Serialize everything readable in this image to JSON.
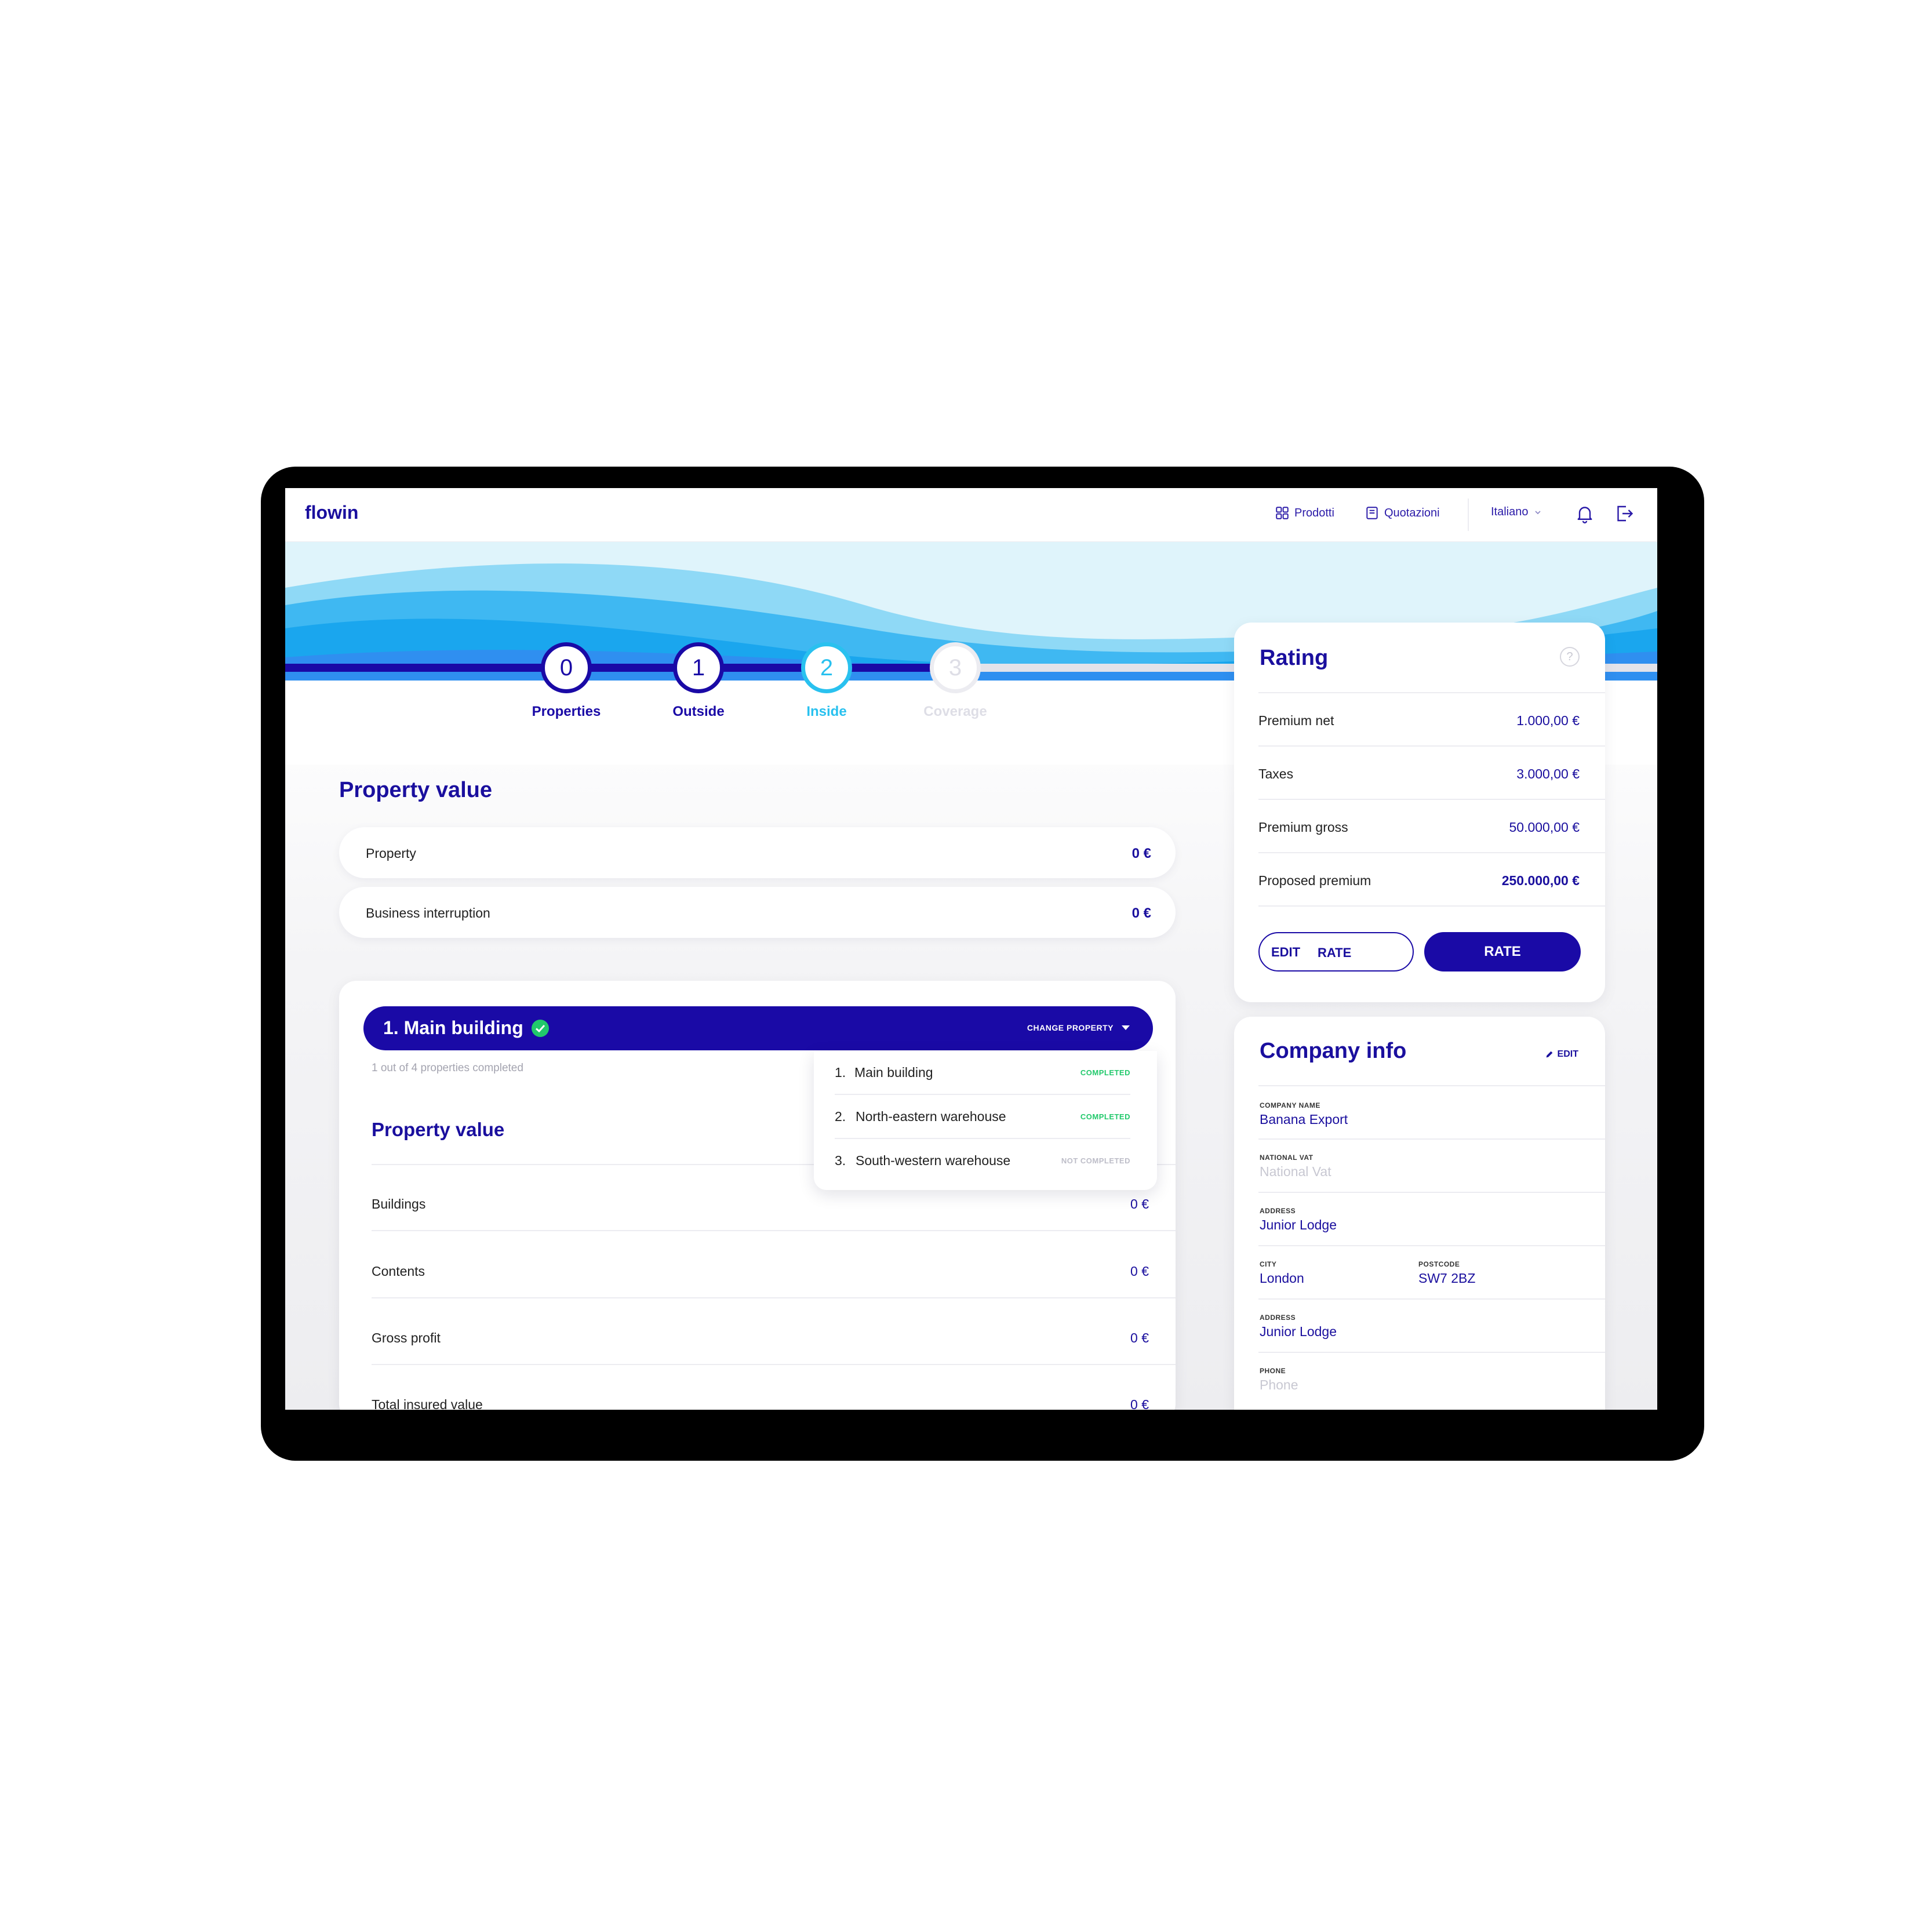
{
  "header": {
    "logo": "flowin",
    "nav": [
      {
        "label": "Prodotti",
        "icon": "grid-icon"
      },
      {
        "label": "Quotazioni",
        "icon": "document-icon"
      }
    ],
    "language": "Italiano",
    "icons": [
      "bell-icon",
      "logout-icon"
    ]
  },
  "stepper": {
    "steps": [
      {
        "number": "0",
        "label": "Properties",
        "state": "done"
      },
      {
        "number": "1",
        "label": "Outside",
        "state": "done"
      },
      {
        "number": "2",
        "label": "Inside",
        "state": "current"
      },
      {
        "number": "3",
        "label": "Coverage",
        "state": "pending"
      }
    ]
  },
  "property_value": {
    "title": "Property value",
    "rows": [
      {
        "label": "Property",
        "value": "0 €"
      },
      {
        "label": "Business interruption",
        "value": "0 €"
      }
    ]
  },
  "main_building": {
    "title": "1.  Main building",
    "change_label": "CHANGE PROPERTY",
    "progress": "1 out of 4 properties completed",
    "section_title": "Property value",
    "rows": [
      {
        "label": "Buildings",
        "value": "0 €"
      },
      {
        "label": "Contents",
        "value": "0 €"
      },
      {
        "label": "Gross profit",
        "value": "0 €"
      },
      {
        "label": "Total insured value",
        "value": "0 €"
      }
    ]
  },
  "property_dropdown": {
    "items": [
      {
        "num": "1.",
        "name": "Main building",
        "status": "COMPLETED"
      },
      {
        "num": "2.",
        "name": "North-eastern warehouse",
        "status": "COMPLETED"
      },
      {
        "num": "3.",
        "name": "South-western warehouse",
        "status": "NOT COMPLETED"
      }
    ]
  },
  "rating": {
    "title": "Rating",
    "help_icon": "?",
    "rows": [
      {
        "label": "Premium net",
        "value": "1.000,00 €"
      },
      {
        "label": "Taxes",
        "value": "3.000,00 €"
      },
      {
        "label": "Premium gross",
        "value": "50.000,00 €"
      },
      {
        "label": "Proposed premium",
        "value": "250.000,00 €"
      }
    ],
    "edit_label": "EDIT",
    "edit_rate_label": "RATE",
    "rate_label": "RATE"
  },
  "company_info": {
    "title": "Company info",
    "edit_label": "EDIT",
    "company_name": {
      "caption": "COMPANY NAME",
      "value": "Banana Export"
    },
    "national_vat": {
      "caption": "NATIONAL VAT",
      "placeholder": "National Vat"
    },
    "address1": {
      "caption": "ADDRESS",
      "value": "Junior Lodge"
    },
    "city": {
      "caption": "CITY",
      "value": "London"
    },
    "postcode": {
      "caption": "POSTCODE",
      "value": "SW7 2BZ"
    },
    "address2": {
      "caption": "ADDRESS",
      "value": "Junior Lodge"
    },
    "phone": {
      "caption": "PHONE",
      "placeholder": "Phone"
    }
  },
  "colors": {
    "primary": "#1a0aa6",
    "current_step": "#29c1ef",
    "completed": "#21c96b",
    "muted": "#c8c8d2"
  }
}
